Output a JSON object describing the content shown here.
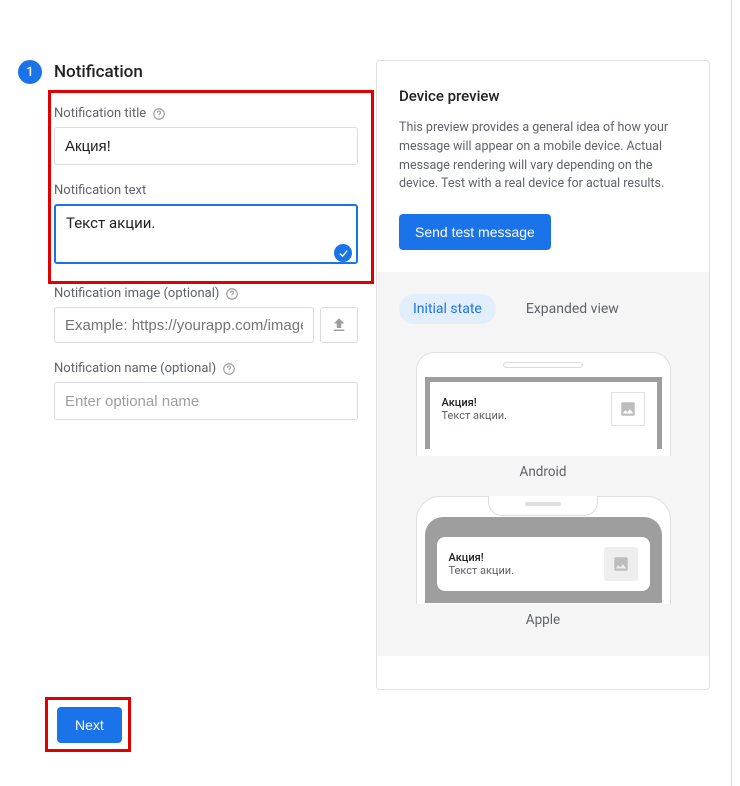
{
  "step": {
    "number": "1",
    "title": "Notification"
  },
  "fields": {
    "title": {
      "label": "Notification title",
      "value": "Акция!"
    },
    "text": {
      "label": "Notification text",
      "value": "Текст акции."
    },
    "image": {
      "label": "Notification image (optional)",
      "placeholder": "Example: https://yourapp.com/image.png"
    },
    "name": {
      "label": "Notification name (optional)",
      "placeholder": "Enter optional name"
    }
  },
  "preview": {
    "title": "Device preview",
    "description": "This preview provides a general idea of how your message will appear on a mobile device. Actual message rendering will vary depending on the device. Test with a real device for actual results.",
    "sendTest": "Send test message",
    "tabs": {
      "initial": "Initial state",
      "expanded": "Expanded view"
    },
    "devices": {
      "android": "Android",
      "apple": "Apple"
    },
    "notif": {
      "title": "Акция!",
      "body": "Текст акции."
    }
  },
  "actions": {
    "next": "Next"
  }
}
